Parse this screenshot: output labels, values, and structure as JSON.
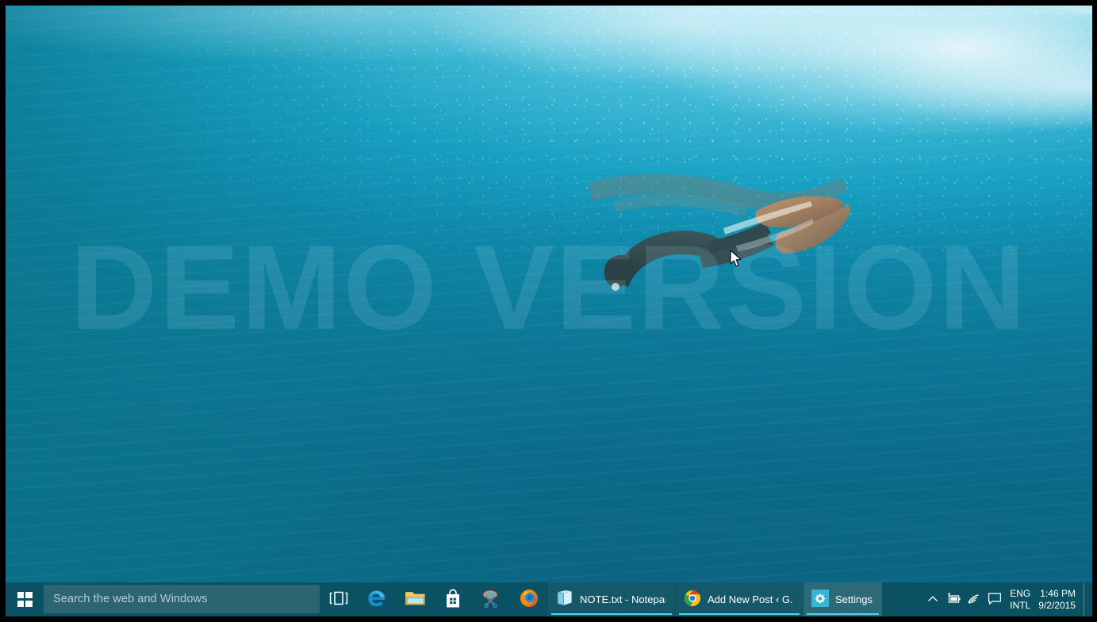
{
  "desktop": {
    "wallpaper_name": "underwater-diver-wallpaper",
    "watermark": "DEMO VERSION",
    "cursor": "arrow-cursor"
  },
  "colors": {
    "taskbar_bg": "#0a5163",
    "search_bg": "#2c6472",
    "accent": "#4fd4e4",
    "settings_tile": "#37b6d3",
    "frame": "#000000",
    "water_deep": "#0b6585",
    "water_bright": "#bfe9f4"
  },
  "taskbar": {
    "start": {
      "label": "Start",
      "icon": "windows-logo-icon"
    },
    "search": {
      "placeholder": "Search the web and Windows",
      "value": "",
      "icon": "search-box"
    },
    "pinned": [
      {
        "label": "Task View",
        "icon": "task-view-icon"
      },
      {
        "label": "Microsoft Edge",
        "icon": "edge-icon"
      },
      {
        "label": "File Explorer",
        "icon": "file-explorer-icon"
      },
      {
        "label": "Store",
        "icon": "store-icon"
      },
      {
        "label": "Snipping Tool",
        "icon": "snipping-tool-icon"
      },
      {
        "label": "Mozilla Firefox",
        "icon": "firefox-icon"
      }
    ],
    "apps": [
      {
        "label": "NOTE.txt - Notepad",
        "icon": "notepad-icon",
        "active": false
      },
      {
        "label": "Add New Post ‹ G...",
        "icon": "chrome-icon",
        "active": false
      },
      {
        "label": "Settings",
        "icon": "settings-gear-icon",
        "active": true
      }
    ],
    "tray": {
      "chevron": {
        "label": "Show hidden icons",
        "icon": "chevron-up-icon"
      },
      "icons": [
        {
          "label": "Power / Battery",
          "icon": "battery-icon"
        },
        {
          "label": "Network",
          "icon": "wifi-icon"
        },
        {
          "label": "Action Center",
          "icon": "action-center-icon"
        }
      ],
      "language": {
        "line1": "ENG",
        "line2": "INTL"
      },
      "clock": {
        "time": "1:46 PM",
        "date": "9/2/2015"
      },
      "show_desktop": {
        "label": "Show desktop"
      }
    }
  }
}
